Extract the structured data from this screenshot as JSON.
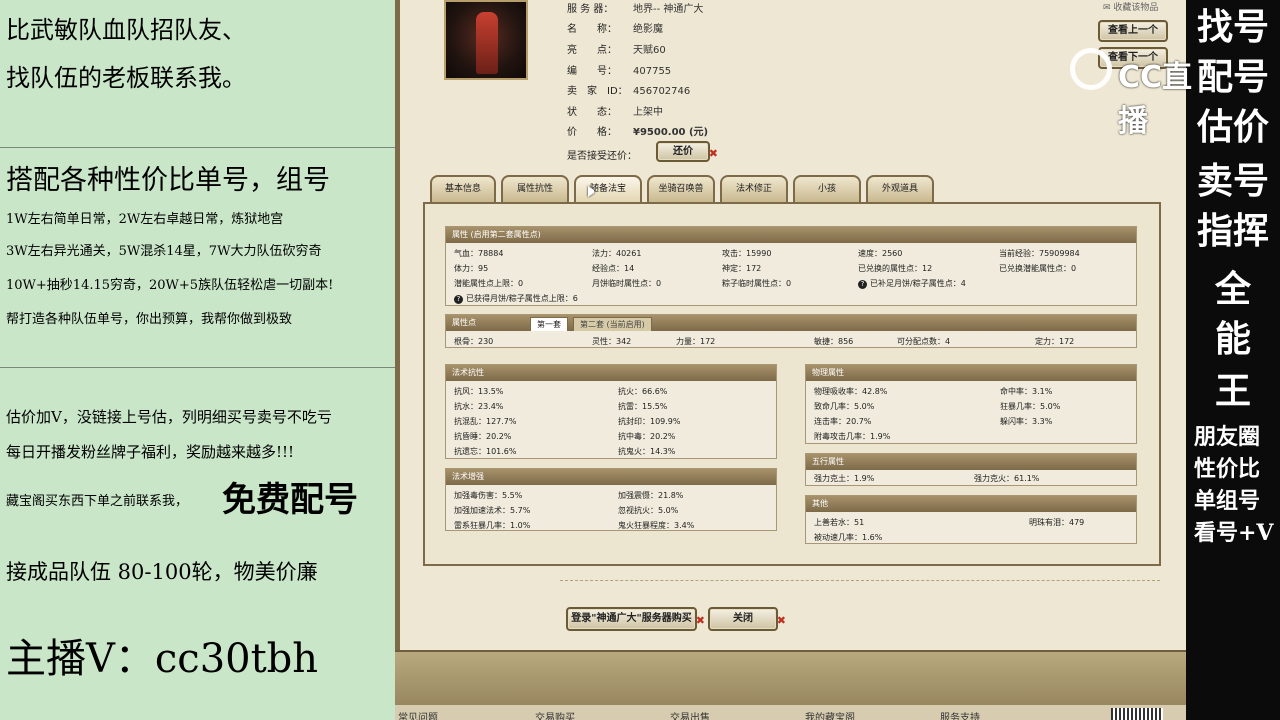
{
  "left_overlay": {
    "lines": [
      "比武敏队血队招队友、",
      "找队伍的老板联系我。",
      "搭配各种性价比单号，组号",
      "1W左右简单日常，2W左右卓越日常，炼狱地宫",
      "3W左右异光通关，5W混杀14星，7W大力队伍砍穷奇",
      "10W+抽秒14.15穷奇，20W+5族队伍轻松虐一切副本!",
      "帮打造各种队伍单号，你出预算，我帮你做到极致",
      "估价加V，没链接上号估，列明细买号卖号不吃亏",
      "每日开播发粉丝牌子福利，奖励越来越多!!!",
      "藏宝阁买东西下单之前联系我，",
      "免费配号",
      "接成品队伍 80-100轮，物美价廉",
      "主播V：cc30tbh"
    ]
  },
  "right_overlay": {
    "big_chars": [
      "找号",
      "配号",
      "估价",
      "卖号",
      "指挥",
      "全",
      "能",
      "王"
    ],
    "small_lines": [
      "朋友圈",
      "性价比",
      "单组号",
      "看号+V"
    ]
  },
  "logo": {
    "text": "CC直播"
  },
  "game": {
    "collect_label": "收藏该物品",
    "info": [
      {
        "label": "服 务 器：",
        "value": "地界-- 神通广大"
      },
      {
        "label": "名　　称：",
        "value": "绝影魔"
      },
      {
        "label": "亮　　点：",
        "value": "天赋60"
      },
      {
        "label": "编　　号：",
        "value": "407755"
      },
      {
        "label": "卖　家　ID：",
        "value": "456702746"
      },
      {
        "label": "状　　态：",
        "value": "上架中"
      },
      {
        "label": "价　　格：",
        "value": "¥9500.00 (元)"
      },
      {
        "label": "是否接受还价：",
        "value": ""
      }
    ],
    "buttons": {
      "prev": "查看上一个",
      "next": "查看下一个",
      "bargain": "还价",
      "buy": "登录\"神通广大\"服务器购买",
      "close": "关闭"
    },
    "tabs": [
      "基本信息",
      "属性抗性",
      "随备法宝",
      "坐骑召唤兽",
      "法术修正",
      "小孩",
      "外观道具"
    ],
    "attr": {
      "title": "属性 (启用第二套属性点)",
      "rows": [
        [
          "气血：78884",
          "法力：40261",
          "攻击：15990",
          "速度：2560",
          "当前经验：75909984"
        ],
        [
          "体力：95",
          "经验点：14",
          "神定：172",
          "已兑换的属性点：12",
          "已兑换潜能属性点：0"
        ],
        [
          "潜能属性点上限：0",
          "月饼临时属性点：0",
          "粽子临时属性点：0",
          "已补足月饼/粽子属性点：4",
          ""
        ]
      ],
      "note": "已获得月饼/粽子属性点上限：6"
    },
    "points": {
      "title": "属性点",
      "sub_tabs": [
        "第一套",
        "第二套 (当前启用)"
      ],
      "row": [
        "根骨：230",
        "灵性：342",
        "力量：172",
        "敏捷：856",
        "可分配点数：4",
        "定力：172"
      ]
    },
    "resist": {
      "title": "法术抗性",
      "cells": [
        "抗风：13.5%",
        "抗火：66.6%",
        "抗水：23.4%",
        "抗雷：15.5%",
        "抗混乱：127.7%",
        "抗封印：109.9%",
        "抗昏睡：20.2%",
        "抗中毒：20.2%",
        "抗遗忘：101.6%",
        "抗鬼火：14.3%"
      ]
    },
    "boost": {
      "title": "法术增强",
      "cells": [
        "加强毒伤害：5.5%",
        "加强震慑：21.8%",
        "加强加速法术：5.7%",
        "忽视抗火：5.0%",
        "雷系狂暴几率：1.0%",
        "鬼火狂暴程度：3.4%"
      ]
    },
    "physical": {
      "title": "物理属性",
      "cells": [
        "物理吸收率：42.8%",
        "命中率：3.1%",
        "致命几率：5.0%",
        "狂暴几率：5.0%",
        "连击率：20.7%",
        "躲闪率：3.3%",
        "附毒攻击几率：1.9%",
        ""
      ]
    },
    "five": {
      "title": "五行属性",
      "cells": [
        "强力克土：1.9%",
        "强力克火：61.1%"
      ]
    },
    "other": {
      "title": "其他",
      "cells": [
        "上善若水：51",
        "明珠有泪：479",
        "被动速几率：1.6%",
        ""
      ]
    },
    "bottom_links": [
      "常见问题",
      "交易购买",
      "交易出售",
      "我的藏宝阁",
      "服务支持"
    ]
  }
}
